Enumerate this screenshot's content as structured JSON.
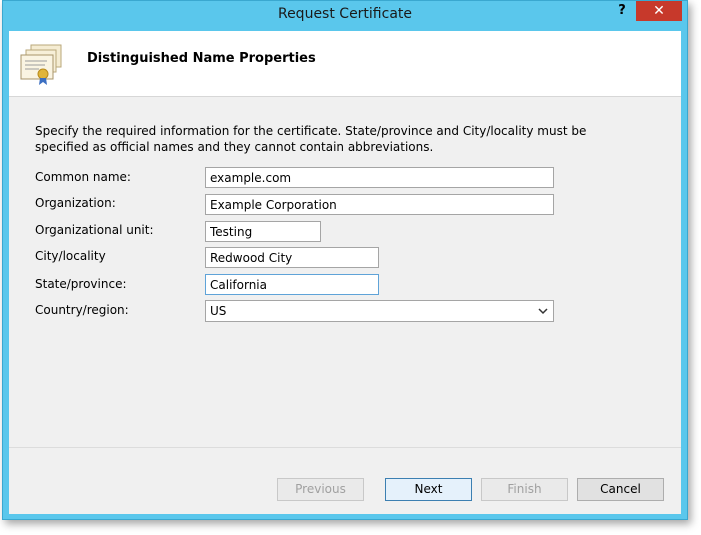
{
  "window": {
    "title": "Request Certificate",
    "help_label": "?",
    "close_label": "✕"
  },
  "header": {
    "title": "Distinguished Name Properties",
    "icon": "certificate-icon"
  },
  "description": "Specify the required information for the certificate. State/province and City/locality must be specified as official names and they cannot contain abbreviations.",
  "fields": {
    "common_name": {
      "label": "Common name:",
      "value": "example.com"
    },
    "organization": {
      "label": "Organization:",
      "value": "Example Corporation"
    },
    "org_unit": {
      "label": "Organizational unit:",
      "value": "Testing"
    },
    "city": {
      "label": "City/locality",
      "value": "Redwood City"
    },
    "state": {
      "label": "State/province:",
      "value": "California"
    },
    "country": {
      "label": "Country/region:",
      "value": "US"
    }
  },
  "buttons": {
    "previous": "Previous",
    "next": "Next",
    "finish": "Finish",
    "cancel": "Cancel"
  },
  "colors": {
    "title_bar": "#5ac7ec",
    "close_button": "#c7392b",
    "focus_border": "#5fa3d8"
  }
}
